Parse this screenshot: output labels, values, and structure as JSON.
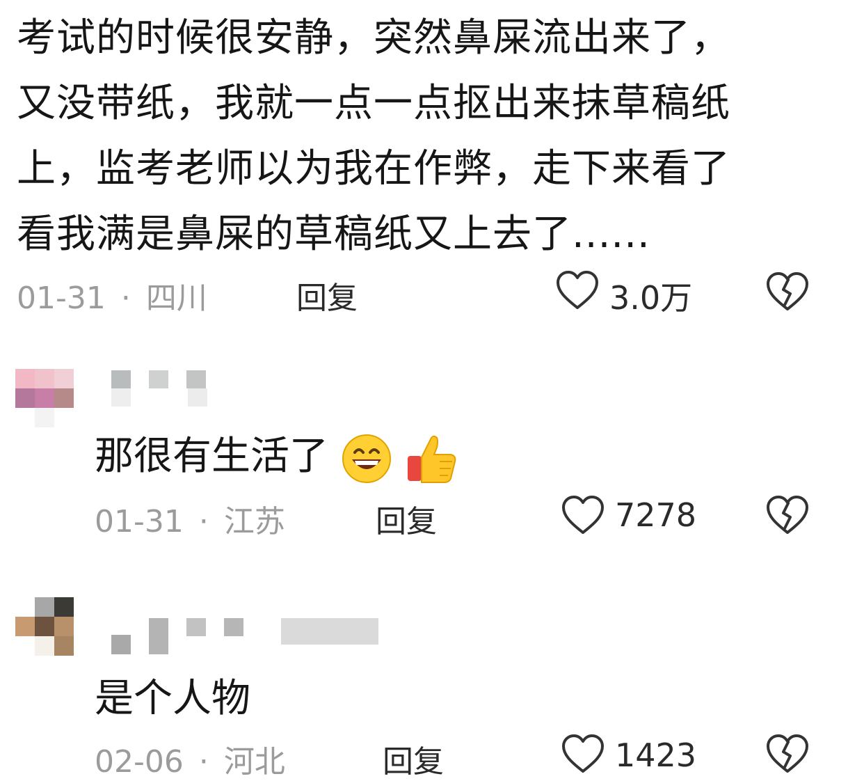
{
  "main_comment": {
    "lines": [
      "考试的时候很安静，突然鼻屎流出来了，",
      "又没带纸，我就一点一点抠出来抹草稿纸",
      "上，监考老师以为我在作弊，走下来看了",
      "看我满是鼻屎的草稿纸又上去了......"
    ],
    "date": "01-31",
    "separator": "·",
    "location": "四川",
    "reply_label": "回复",
    "likes": "3.0万"
  },
  "replies": [
    {
      "text": "那很有生活了",
      "emojis": [
        "grinning-face-icon",
        "thumbs-up-icon"
      ],
      "date": "01-31",
      "separator": "·",
      "location": "江苏",
      "reply_label": "回复",
      "likes": "7278"
    },
    {
      "text": "是个人物",
      "date": "02-06",
      "separator": "·",
      "location": "河北",
      "reply_label": "回复",
      "likes": "1423"
    }
  ],
  "icons": {
    "like": "heart-outline-icon",
    "dislike": "broken-heart-icon"
  },
  "colors": {
    "text": "#161616",
    "meta": "#9b9b9b",
    "icon": "#333333",
    "background": "#ffffff"
  }
}
